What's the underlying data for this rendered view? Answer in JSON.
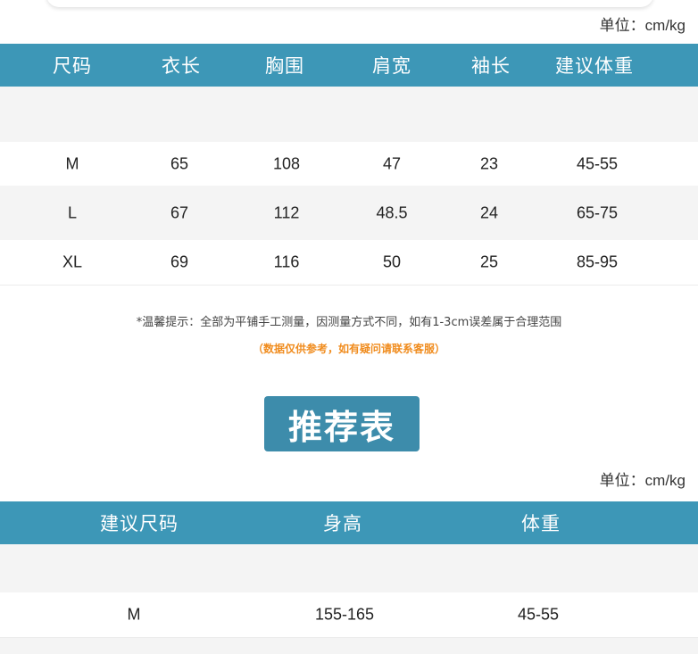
{
  "size_table": {
    "unit": "单位：cm/kg",
    "headers": [
      "尺码",
      "衣长",
      "胸围",
      "肩宽",
      "袖长",
      "建议体重"
    ],
    "rows": [
      [
        "M",
        "65",
        "108",
        "47",
        "23",
        "45-55"
      ],
      [
        "L",
        "67",
        "112",
        "48.5",
        "24",
        "65-75"
      ],
      [
        "XL",
        "69",
        "116",
        "50",
        "25",
        "85-95"
      ]
    ]
  },
  "notes": {
    "tip": "*温馨提示：全部为平铺手工测量，因测量方式不同，如有1-3cm误差属于合理范围",
    "reference": "（数据仅供参考，如有疑问请联系客服）"
  },
  "recommend": {
    "title": "推荐表",
    "unit": "单位：cm/kg",
    "headers": [
      "建议尺码",
      "身高",
      "体重"
    ],
    "rows": [
      [
        "M",
        "155-165",
        "45-55"
      ]
    ]
  },
  "colors": {
    "header_bg": "#3d97b7",
    "badge_bg": "#3d8cab",
    "band_gray": "#f4f4f4",
    "note_orange": "#f08c1e"
  }
}
